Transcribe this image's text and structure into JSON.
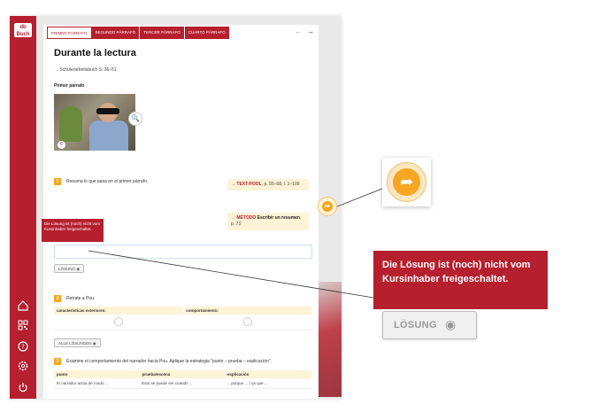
{
  "app": {
    "logo_line1": "db",
    "logo_line2": "Buch"
  },
  "tabs": [
    {
      "label": "PRIMER PÁRRAFO"
    },
    {
      "label": "SEGUNDO PÁRRAFO"
    },
    {
      "label": "TERCER PÁRRAFO"
    },
    {
      "label": "CUARTO PÁRRAFO"
    }
  ],
  "nav": {
    "prev": "←",
    "next": "→"
  },
  "page": {
    "title": "Durante la lectura",
    "subtitle": "→ Schülerarbeitsbuch S. 36–51",
    "section": "Primer párrafo"
  },
  "task1": {
    "number": "1",
    "text": "Resuma lo que pasa en el primer párrafo.",
    "info1_title": "TEXT-POOL",
    "info1_text": ", p. 55–58, l. 1–109",
    "info2_title": "MÉTODO",
    "info2_text": " Escribir un resumen",
    "info2_page": ", p. 73",
    "solution_button": "LÖSUNG"
  },
  "tooltip_small": "Die Lösung ist (noch) nicht vom Kursinhaber freigeschaltet.",
  "task2": {
    "number": "2",
    "text": "Retrate a Pou.",
    "col1": "características exteriores:",
    "col2": "comportamiento:",
    "all_solutions": "ALLE LÖSUNGEN"
  },
  "task3": {
    "number": "3",
    "text": "Examine el comportamiento del narrador hacia Pou. Aplique la estrategia \"punto – prueba – explicación\".",
    "headers": [
      "punto",
      "prueba/escena",
      "explicación"
    ],
    "row": [
      "El narrador actúa de modo ...",
      "Esto se puede ver cuando ...",
      "... porque ... / ya que ..."
    ]
  },
  "callout": {
    "text": "Die Lösung ist (noch) nicht vom Kursinhaber freigeschaltet."
  },
  "big_button": {
    "label": "LÖSUNG"
  },
  "colors": {
    "brand": "#b51f2e",
    "accent": "#f5a623",
    "info_bg": "#fdf3d6"
  }
}
